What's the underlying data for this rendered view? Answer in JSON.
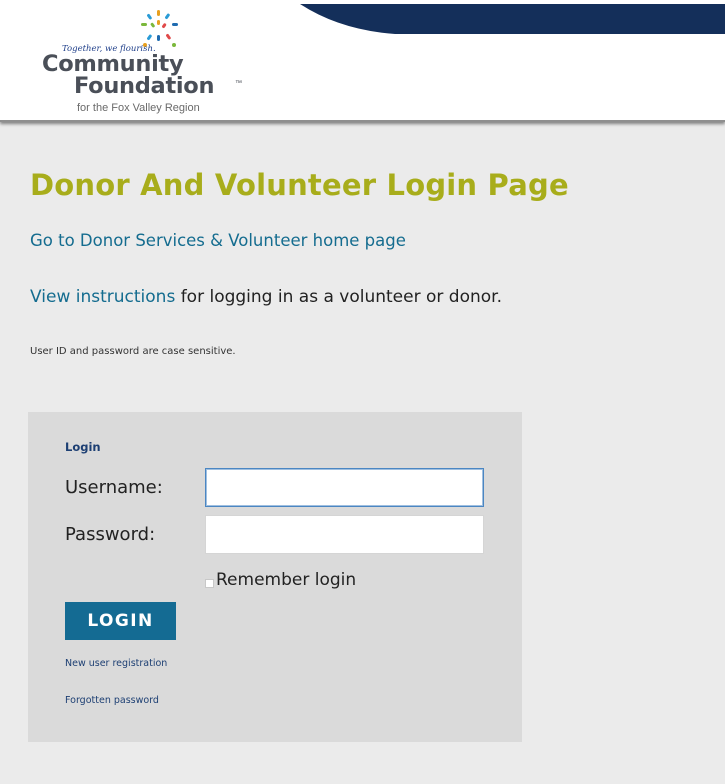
{
  "logo": {
    "tagline": "Together, we flourish.",
    "word1": "Community",
    "word2": "Foundation",
    "trademark": "™",
    "region": "for the Fox Valley Region"
  },
  "colors": {
    "header_band": "#142f5a",
    "title": "#a8ad1b",
    "link": "#146c8f",
    "button": "#146b93",
    "box": "#dadada",
    "page_bg": "#ebebeb"
  },
  "page": {
    "title": "Donor And Volunteer Login Page",
    "home_link": "Go to Donor Services & Volunteer home page",
    "instructions_link": "View instructions",
    "instructions_text": " for logging in as a volunteer or donor.",
    "case_note": "User ID and password are case sensitive."
  },
  "login": {
    "heading": "Login",
    "username_label": "Username:",
    "username_value": "",
    "password_label": "Password:",
    "password_value": "",
    "remember_label": "Remember login",
    "remember_checked": false,
    "button_label": "LOGIN",
    "register_link": "New user registration",
    "forgot_link": "Forgotten password"
  }
}
